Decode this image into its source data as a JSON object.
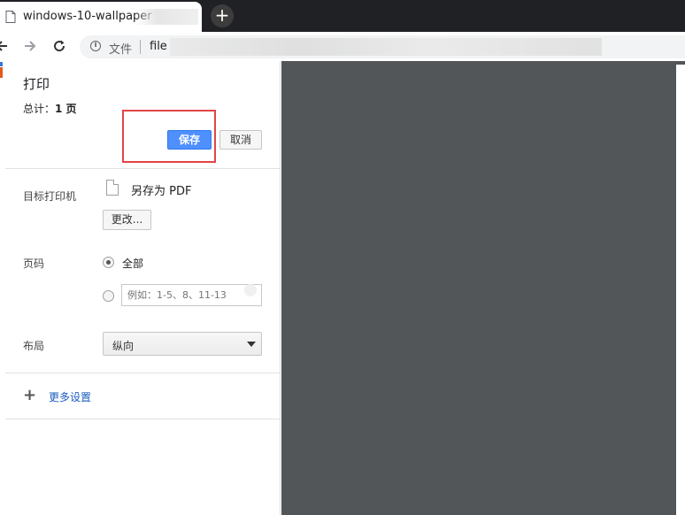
{
  "browser": {
    "tab_title": "windows-10-wallpaper",
    "new_tab_symbol": "+",
    "nav": {
      "back_icon": "arrow-left-icon",
      "forward_icon": "arrow-right-icon",
      "reload_icon": "reload-icon"
    },
    "address": {
      "scheme_label": "文件",
      "url": "file"
    }
  },
  "print": {
    "title": "打印",
    "total_label": "总计：",
    "total_value": "1 页",
    "save_label": "保存",
    "cancel_label": "取消",
    "destination": {
      "label": "目标打印机",
      "value": "另存为 PDF",
      "change_label": "更改..."
    },
    "pages": {
      "label": "页码",
      "all_label": "全部",
      "custom_placeholder": "例如：1-5、8、11-13",
      "selected": "all"
    },
    "layout": {
      "label": "布局",
      "value": "纵向"
    },
    "more_settings_label": "更多设置"
  },
  "colors": {
    "accent": "#4d90fe",
    "highlight_box": "#e34545",
    "preview_bg": "#525659",
    "link": "#1a5dbf"
  }
}
